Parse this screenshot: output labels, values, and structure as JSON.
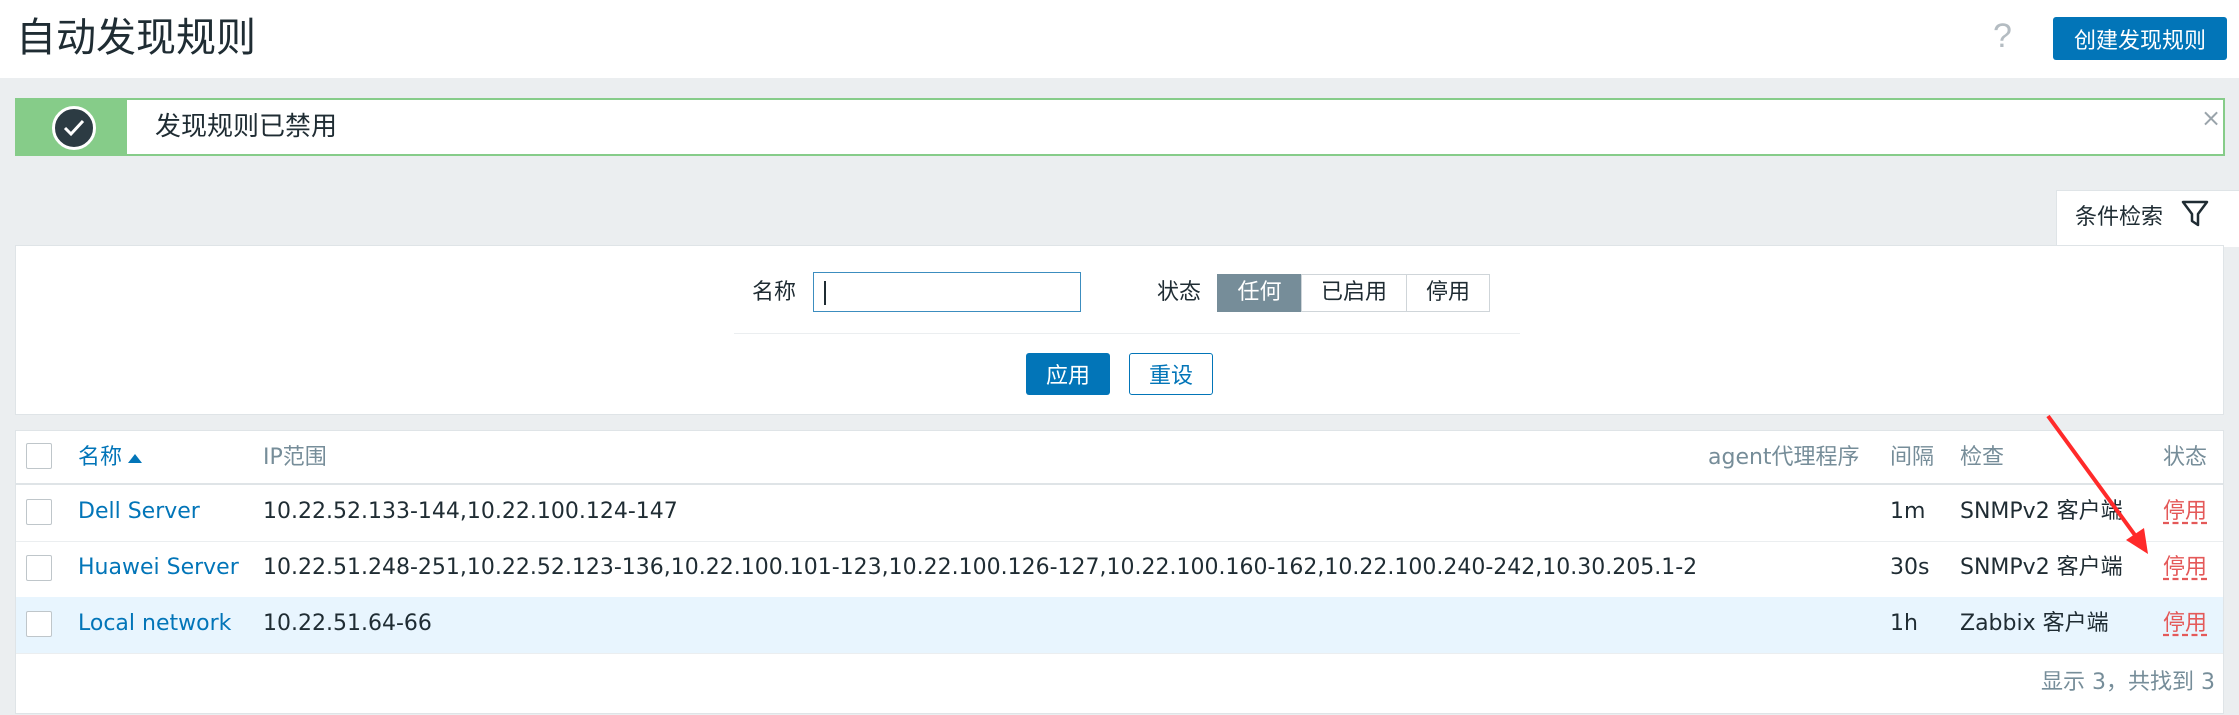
{
  "header": {
    "title": "自动发现规则",
    "help_icon": "?",
    "create_button": "创建发现规则"
  },
  "message": {
    "text": "发现规则已禁用",
    "icon": "check-circle-icon",
    "close_glyph": "×"
  },
  "filter": {
    "tab_label": "条件检索",
    "name_label": "名称",
    "name_value": "",
    "status_label": "状态",
    "status_options": [
      "任何",
      "已启用",
      "停用"
    ],
    "status_selected": "任何",
    "apply_button": "应用",
    "reset_button": "重设"
  },
  "table": {
    "columns": {
      "name": "名称",
      "ip_range": "IP范围",
      "proxy": "agent代理程序",
      "interval": "间隔",
      "checks": "检查",
      "status": "状态"
    },
    "rows": [
      {
        "name": "Dell Server",
        "ip_range": "10.22.52.133-144,10.22.100.124-147",
        "proxy": "",
        "interval": "1m",
        "checks": "SNMPv2 客户端",
        "status": "停用"
      },
      {
        "name": "Huawei Server",
        "ip_range": "10.22.51.248-251,10.22.52.123-136,10.22.100.101-123,10.22.100.126-127,10.22.100.160-162,10.22.100.240-242,10.30.205.1-2",
        "proxy": "",
        "interval": "30s",
        "checks": "SNMPv2 客户端",
        "status": "停用"
      },
      {
        "name": "Local network",
        "ip_range": "10.22.51.64-66",
        "proxy": "",
        "interval": "1h",
        "checks": "Zabbix 客户端",
        "status": "停用"
      }
    ],
    "footer": "显示 3，共找到 3"
  },
  "colors": {
    "accent": "#0275b8",
    "success": "#86cc89",
    "disabled_status": "#e45959",
    "annotation_arrow": "#ff2a2a"
  }
}
